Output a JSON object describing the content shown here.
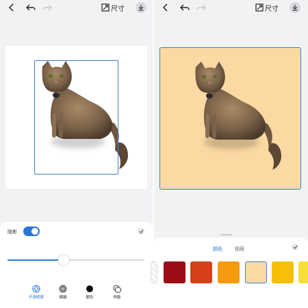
{
  "toolbar": {
    "size_label": "尺寸"
  },
  "left_panel": {
    "shadow_label": "陰影",
    "shadow_enabled": true,
    "slider_value": 0.41,
    "tools": [
      {
        "label": "不透明度",
        "icon": "opacity-icon",
        "active": true
      },
      {
        "label": "模糊",
        "icon": "blur-icon",
        "active": false
      },
      {
        "label": "顏色",
        "icon": "color-dot-icon",
        "active": false
      },
      {
        "label": "移動",
        "icon": "move-icon",
        "active": false
      }
    ]
  },
  "right_panel": {
    "tabs": [
      {
        "label": "顏色",
        "active": true
      },
      {
        "label": "相冊",
        "active": false
      }
    ],
    "swatches": [
      "#9c0d18",
      "#d6411a",
      "#f59a0c",
      "#fbd9a3",
      "#f6c007",
      "#f7e03a"
    ],
    "selected_swatch": 3
  },
  "colors": {
    "accent": "#2a75d8",
    "canvas_background": "#fbd9a3"
  }
}
